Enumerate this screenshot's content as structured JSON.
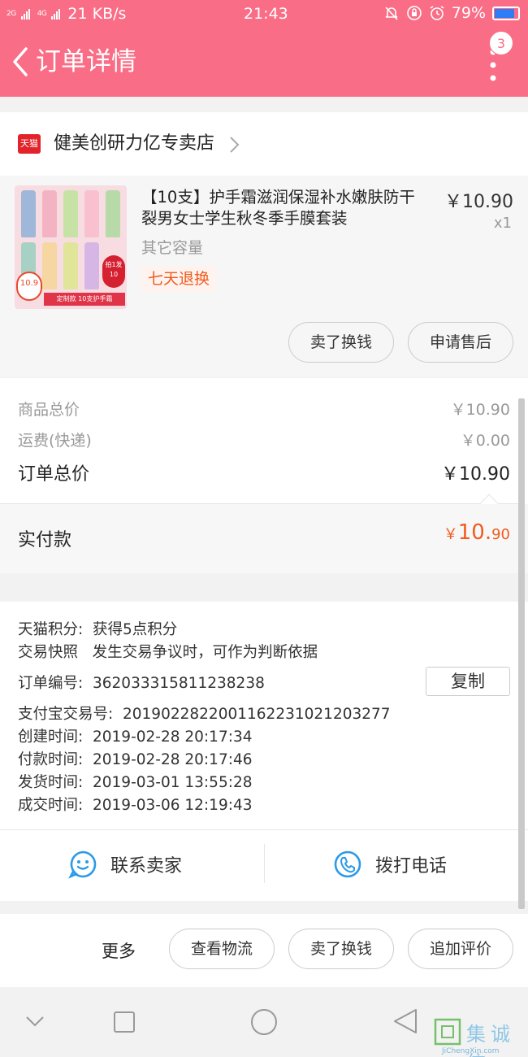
{
  "status_bar": {
    "signal_1": "2G",
    "signal_2": "4G",
    "net_speed": "21 KB/s",
    "time": "21:43",
    "battery": "79%",
    "battery_level": 0.79
  },
  "header": {
    "title": "订单详情",
    "badge_count": "3"
  },
  "shop": {
    "logo_text": "天猫",
    "name": "健美创研力亿专卖店"
  },
  "product": {
    "title": "【10支】护手霜滋润保湿补水嫩肤防干裂男女士学生秋冬季手膜套装",
    "price": "￥10.90",
    "quantity": "x1",
    "spec": "其它容量",
    "badge": "七天退换",
    "thumb_promo": "拍1发10",
    "thumb_price": "10.9",
    "thumb_strip": "定制款 10支护手霜",
    "actions": [
      "卖了换钱",
      "申请售后"
    ]
  },
  "summary": {
    "items": [
      {
        "label": "商品总价",
        "value": "￥10.90"
      },
      {
        "label": "运费(快递)",
        "value": "￥0.00"
      }
    ],
    "total_label": "订单总价",
    "total_value": "￥10.90",
    "paid_label": "实付款",
    "paid_currency": "￥",
    "paid_int": "10.",
    "paid_dec": "90"
  },
  "details": {
    "points_label": "天猫积分:",
    "points_value": "获得5点积分",
    "snapshot_label": "交易快照",
    "snapshot_value": "发生交易争议时，可作为判断依据",
    "order_no_label": "订单编号:",
    "order_no_value": "362033315811238238",
    "copy_label": "复制",
    "alipay_label": "支付宝交易号:",
    "alipay_value": "2019022822001162231021203277",
    "created_label": "创建时间:",
    "created_value": "2019-02-28 20:17:34",
    "paid_label": "付款时间:",
    "paid_value": "2019-02-28 20:17:46",
    "shipped_label": "发货时间:",
    "shipped_value": "2019-03-01 13:55:28",
    "closed_label": "成交时间:",
    "closed_value": "2019-03-06 12:19:43"
  },
  "contact": {
    "seller_label": "联系卖家",
    "call_label": "拨打电话"
  },
  "bottom_bar": {
    "more_label": "更多",
    "buttons": [
      "查看物流",
      "卖了换钱",
      "追加评价"
    ]
  },
  "watermark": {
    "text": "集诚信",
    "sub": "JiChengXin.com"
  },
  "colors": {
    "header_bg": "#f96d86",
    "accent_orange": "#f05b1f",
    "tmall_red": "#e2232b",
    "contact_blue": "#2b9ae8"
  },
  "icons": {
    "back": "chevron-left-icon",
    "more": "vertical-dots-icon",
    "shop_arrow": "chevron-right-icon",
    "seller": "smiley-chat-icon",
    "phone": "phone-icon"
  }
}
